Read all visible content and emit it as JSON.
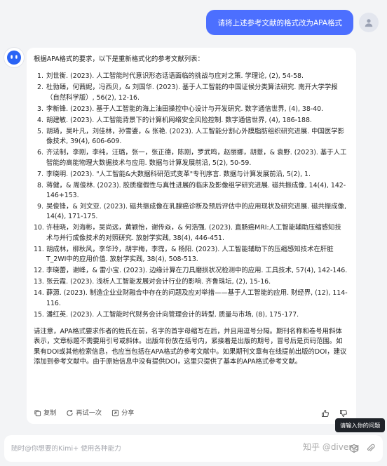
{
  "user_message": "请将上述参考文献的格式改为APA格式",
  "bot": {
    "intro": "根据APA格式的要求，以下是重新格式化的参考文献列表：",
    "references": [
      {
        "num": "1.",
        "text": "刘世衡. (2023). 人工智能时代意识形态话语面临的挑战与应对之策. 学理论, (2), 54-58."
      },
      {
        "num": "2.",
        "text": "杜勃臻，何茜妮，冯西贝，& 刘国华. (2023). 基于人工智能的中国证候分类算法研究. 南开大学学报（自然科学版）, 56(2), 12-16."
      },
      {
        "num": "3.",
        "text": "李新锋. (2023). 基于人工智能的海上油田操控中心设计与开发研究. 数字通信世界, (4), 38-40."
      },
      {
        "num": "4.",
        "text": "胡建敏. (2023). 人工智能背景下的计算机网络安全风险控制. 数字通信世界, (4), 186-188."
      },
      {
        "num": "5.",
        "text": "胡琦，吴叶凡，刘佳林，孙雪婆，& 张艳. (2023). 人工智能分割心外膜脂肪组织研究进展. 中国医学影像技术, 39(4), 606-609."
      },
      {
        "num": "6.",
        "text": "齐法制，李刚，李纯，汪璐，张一，张正德，陈刚，罗武鸣，赵丽娜，胡薏，& 袁野. (2023). 基于人工智能的高能物理大数据技术与应用. 数据与计算发展前沿, 5(2), 50-59."
      },
      {
        "num": "7.",
        "text": "李晓明. (2023). \"人工智能&大数据科研范式变革\"专刊序言. 数据与计算发展前沿, 5(2), 1."
      },
      {
        "num": "8.",
        "text": "蒋健，& 周俊林. (2023). 胶质瘤假性与真性进展的临床及影像组学研究进展. 磁共振成像, 14(4), 142-146+153."
      },
      {
        "num": "9.",
        "text": "吴俊锋，& 刘文亚. (2023). 磁共振成像在乳腺癌诊断及预后评估中的应用现状及研究进展. 磁共振成像, 14(4), 171-175."
      },
      {
        "num": "10.",
        "text": "许桂晓，刘海彬，吴尚远，黄颖怡，谢传焱，& 何浩强. (2023). 直肠癌MRI:人工智能辅助压缩感知技术与并行成像技术的对照研究. 放射学实践, 38(4), 446-451."
      },
      {
        "num": "11.",
        "text": "胡成林，柳秋风，李华玲，胡宇梅，李霈，& 杨阳. (2023). 人工智能辅助下的压缩感知技术在肝脏T_2WI中的应用价值. 放射学实践, 38(4), 508-513."
      },
      {
        "num": "12.",
        "text": "李晓蕾，谢峰，& 雷小宝. (2023). 边缘计算在刀具磨损状况检测中的应用. 工具技术, 57(4), 142-146."
      },
      {
        "num": "13.",
        "text": "张云霞. (2023). 浅析人工智能发展对会计行业的影响. 齐鲁珠坛, (2), 15-16."
      },
      {
        "num": "14.",
        "text": "薛源. (2023). 制造企业业财融合中存在的问题及应对举措——基于人工智能的应用. 财经界, (12), 114-116."
      },
      {
        "num": "15.",
        "text": "潘红英. (2023). 人工智能时代财务会计向管理会计的转型. 质量与市场, (8), 175-177."
      }
    ],
    "note": "请注意，APA格式要求作者的姓氏在前，名字的首字母缩写在后，并且用逗号分隔。期刊名称和卷号用斜体表示，文章标题不需要用引号或斜体。出版年份放在括号内，紧接着是出版的期号，冒号后是页码范围。如果有DOI或其他检索信息，也应当包括在APA格式的参考文献中。如果期刊文章有在线提前出版的DOI，建议添加到参考文献中。由于原始信息中没有提供DOI，这里只提供了基本的APA格式参考文献。"
  },
  "actions": {
    "copy": "复制",
    "regenerate": "再试一次",
    "share": "分享"
  },
  "tooltip": "请输入你的问题",
  "input": {
    "placeholder": "随时@你想要的Kimi+ 使用各种能力"
  },
  "watermark": "知乎 @diveng",
  "colors": {
    "accent": "#4c6fff",
    "background": "#f3f4f6",
    "card": "#ffffff"
  }
}
